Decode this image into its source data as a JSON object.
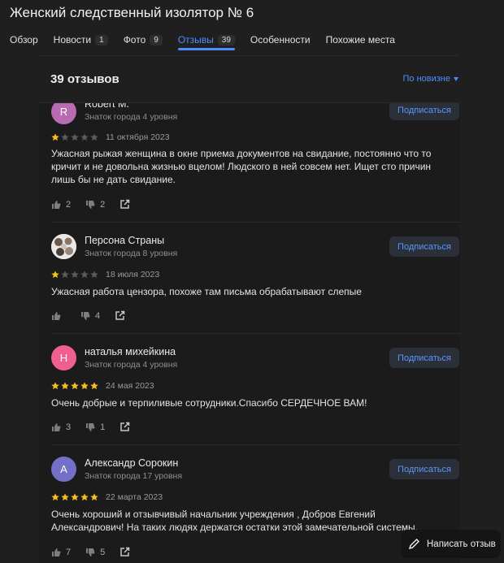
{
  "page": {
    "title": "Женский следственный изолятор № 6"
  },
  "tabs": [
    {
      "label": "Обзор",
      "count": ""
    },
    {
      "label": "Новости",
      "count": "1"
    },
    {
      "label": "Фото",
      "count": "9"
    },
    {
      "label": "Отзывы",
      "count": "39",
      "active": true
    },
    {
      "label": "Особенности",
      "count": ""
    },
    {
      "label": "Похожие места",
      "count": ""
    }
  ],
  "reviews_header": {
    "count_label": "39 отзывов",
    "sort_label": "По новизне"
  },
  "colors": {
    "accent": "#4d8eff",
    "star_filled": "#f6c21a",
    "star_empty": "#5a5a5a"
  },
  "reviews": [
    {
      "author": "Robert M.",
      "avatar_letter": "R",
      "avatar_color": "#b86bb0",
      "level": "Знаток города 4 уровня",
      "subscribe_label": "Подписаться",
      "rating": 1,
      "date": "11 октября 2023",
      "text": "Ужасная рыжая женщина в окне приема документов на свидание, постоянно что то кричит и не довольна жизнью вцелом! Людского в ней совсем нет. Ищет сто причин лишь бы не дать свидание.",
      "likes": "2",
      "dislikes": "2"
    },
    {
      "author": "Персона Страны",
      "avatar_letter": "",
      "avatar_color": "#d8d8d8",
      "level": "Знаток города 8 уровня",
      "subscribe_label": "Подписаться",
      "rating": 1,
      "date": "18 июля 2023",
      "text": "Ужасная работа цензора, похоже там письма обрабатывают слепые",
      "likes": "",
      "dislikes": "4"
    },
    {
      "author": "наталья михейкина",
      "avatar_letter": "Н",
      "avatar_color": "#f0608f",
      "level": "Знаток города 4 уровня",
      "subscribe_label": "Подписаться",
      "rating": 5,
      "date": "24 мая 2023",
      "text": "Очень добрые и терпиливые сотрудники.Спасибо СЕРДЕЧНОЕ ВАМ!",
      "likes": "3",
      "dislikes": "1"
    },
    {
      "author": "Александр Сорокин",
      "avatar_letter": "А",
      "avatar_color": "#7470c8",
      "level": "Знаток города 17 уровня",
      "subscribe_label": "Подписаться",
      "rating": 5,
      "date": "22 марта 2023",
      "text": "Очень хороший и отзывчивый начальник учреждения , Добров Евгений Александрович! На таких людях держатся остатки этой замечательной системы.",
      "likes": "7",
      "dislikes": "5"
    }
  ],
  "write_review": {
    "label": "Написать отзыв"
  }
}
